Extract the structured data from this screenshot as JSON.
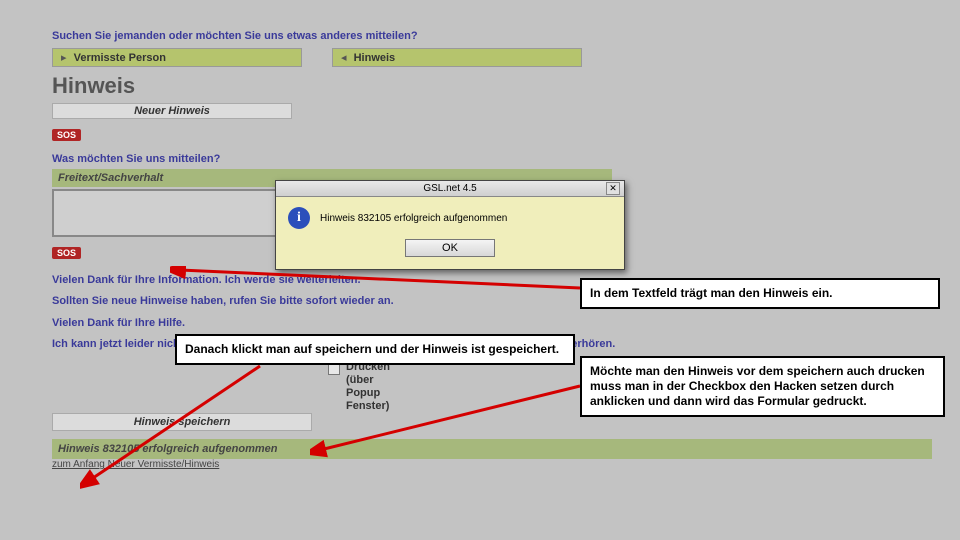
{
  "header": {
    "question": "Suchen Sie jemanden oder möchten Sie uns etwas anderes mitteilen?"
  },
  "tabs": {
    "missing": "Vermisste Person",
    "hint": "Hinweis",
    "triangle_right": "▸",
    "triangle_down": "◂"
  },
  "section_title": "Hinweis",
  "new_hint_btn": "Neuer Hinweis",
  "sos": "SOS",
  "ask": "Was möchten Sie uns mitteilen?",
  "freitext_label": "Freitext/Sachverhalt",
  "thanks": {
    "l1": "Vielen Dank für Ihre Information. Ich werde sie weiterleiten.",
    "l2": "Sollten Sie neue Hinweise haben, rufen Sie bitte sofort wieder an.",
    "l3": "Vielen Dank für Ihre Hilfe.",
    "l4": "Ich kann jetzt leider nicht weiter mit Ihnen sprechen, da noch viele andere Anrufer warten. Auf Wiederhören."
  },
  "print": {
    "l1": "Drucken",
    "l2": "(über",
    "l3": "Popup",
    "l4": "Fenster)"
  },
  "save_btn": "Hinweis speichern",
  "done_bar": "Hinweis 832105 erfolgreich aufgenommen",
  "done_link": "zum Anfang Neuer Vermisste/Hinweis",
  "dialog": {
    "title": "GSL.net 4.5",
    "msg": "Hinweis 832105 erfolgreich aufgenommen",
    "ok": "OK",
    "close": "✕",
    "icon": "i"
  },
  "notes": {
    "n1": "In dem Textfeld trägt man den Hinweis ein.",
    "n2": "Danach klickt man auf speichern und der Hinweis ist gespeichert.",
    "n3": "Möchte man den Hinweis vor dem speichern auch drucken muss man in der Checkbox den Hacken setzen durch anklicken und dann wird das Formular gedruckt."
  }
}
